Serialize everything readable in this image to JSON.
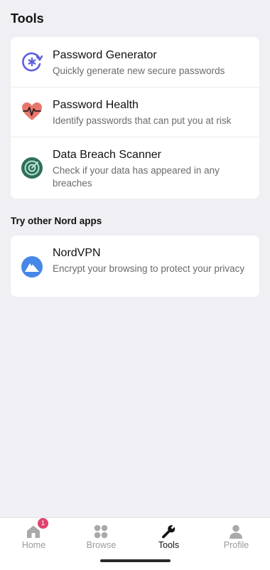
{
  "header": {
    "title": "Tools"
  },
  "tools": [
    {
      "title": "Password Generator",
      "subtitle": "Quickly generate new secure passwords",
      "icon": "password-generator-icon"
    },
    {
      "title": "Password Health",
      "subtitle": "Identify passwords that can put you at risk",
      "icon": "heart-pulse-icon"
    },
    {
      "title": "Data Breach Scanner",
      "subtitle": "Check if your data has appeared in any breaches",
      "icon": "radar-icon"
    }
  ],
  "other_apps": {
    "label": "Try other Nord apps",
    "items": [
      {
        "title": "NordVPN",
        "subtitle": "Encrypt your browsing to protect your privacy",
        "icon": "nordvpn-icon"
      }
    ]
  },
  "tabbar": {
    "items": [
      {
        "label": "Home",
        "icon": "home-icon",
        "badge": "1",
        "active": false
      },
      {
        "label": "Browse",
        "icon": "grid-icon",
        "active": false
      },
      {
        "label": "Tools",
        "icon": "wrench-icon",
        "active": true
      },
      {
        "label": "Profile",
        "icon": "person-icon",
        "active": false
      }
    ]
  },
  "colors": {
    "background": "#efeff4",
    "card": "#ffffff",
    "accent_purple": "#5f5fe0",
    "health_red": "#e8766c",
    "scanner_green": "#2f6e5b",
    "vpn_blue": "#4687e8",
    "badge": "#e0436d"
  }
}
